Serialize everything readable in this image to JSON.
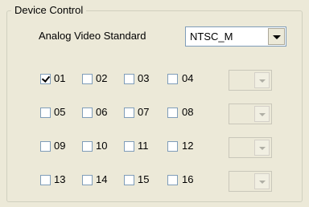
{
  "group": {
    "title": "Device Control"
  },
  "video_standard": {
    "label": "Analog Video Standard",
    "value": "NTSC_M"
  },
  "channels": [
    {
      "label": "01",
      "checked": true
    },
    {
      "label": "02",
      "checked": false
    },
    {
      "label": "03",
      "checked": false
    },
    {
      "label": "04",
      "checked": false
    },
    {
      "label": "05",
      "checked": false
    },
    {
      "label": "06",
      "checked": false
    },
    {
      "label": "07",
      "checked": false
    },
    {
      "label": "08",
      "checked": false
    },
    {
      "label": "09",
      "checked": false
    },
    {
      "label": "10",
      "checked": false
    },
    {
      "label": "11",
      "checked": false
    },
    {
      "label": "12",
      "checked": false
    },
    {
      "label": "13",
      "checked": false
    },
    {
      "label": "14",
      "checked": false
    },
    {
      "label": "15",
      "checked": false
    },
    {
      "label": "16",
      "checked": false
    }
  ],
  "row_selects": [
    {
      "value": "",
      "enabled": false
    },
    {
      "value": "",
      "enabled": false
    },
    {
      "value": "",
      "enabled": false
    },
    {
      "value": "",
      "enabled": false
    }
  ]
}
